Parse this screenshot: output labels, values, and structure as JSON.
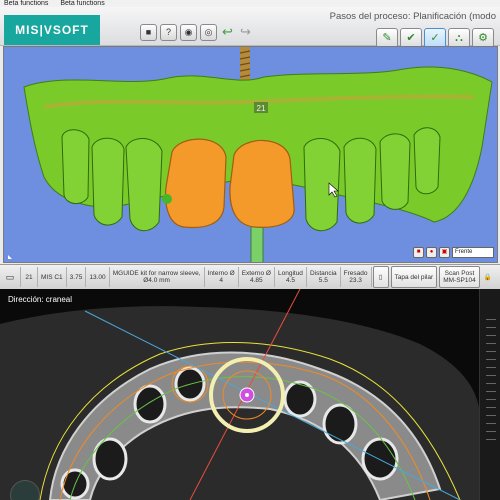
{
  "menu": [
    "Beta functions",
    "Beta functions"
  ],
  "toolbar": {
    "logo": "MIS|VSOFT",
    "buttons": [
      "square-icon",
      "help-icon",
      "camera-rear-icon",
      "camera-icon"
    ],
    "undo": "↩",
    "redo": "↪"
  },
  "process": {
    "label": "Pasos del proceso: Planificación (modo",
    "steps": [
      "✎",
      "✔",
      "✓",
      "⛬",
      "⚙"
    ]
  },
  "view3d": {
    "implant_label": "21",
    "view_select": "Frente"
  },
  "implant_info": {
    "tooth": "21",
    "model": "MIS C1",
    "diameter": "3.75",
    "length": "13.00",
    "kit": "MGUIDE kit for narrow sleeve, Ø4.0 mm",
    "fields": [
      {
        "label": "Interno Ø",
        "value": "4"
      },
      {
        "label": "Externo Ø",
        "value": "4.85"
      },
      {
        "label": "Longitud",
        "value": "4.5"
      },
      {
        "label": "Distancia",
        "value": "5.5"
      },
      {
        "label": "Fresado",
        "value": "23.3"
      }
    ],
    "cap": "Tapa del pilar",
    "scan_post_label": "Scan Post",
    "scan_post_value": "MM-SP104"
  },
  "ct": {
    "direction": "Dirección: craneal"
  },
  "colors": {
    "background_3d": "#6e8fe0",
    "gum": "#7acb2a",
    "crown": "#f39a2b",
    "accent": "#17a79e"
  }
}
